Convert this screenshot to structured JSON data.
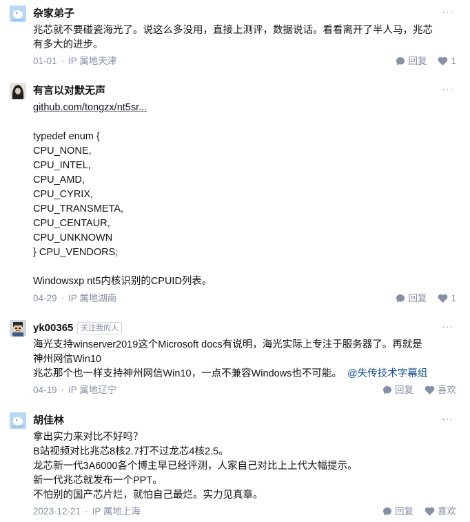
{
  "colors": {
    "meta": "#8590a6",
    "text": "#121212",
    "mention": "#175199",
    "background": "#ffffff"
  },
  "comments": [
    {
      "author": "杂家弟子",
      "avatar_icon": "blue-bird-default-avatar",
      "body_lines": [
        "兆芯就不要碰瓷海光了。说这么多没用，直接上测评，数据说话。看看离开了半人马，兆芯",
        "有多大的进步。"
      ],
      "date": "01-01",
      "location": "IP 属地天津",
      "reply_label": "回复",
      "like_count": "1"
    },
    {
      "author": "有言以对默无声",
      "avatar_icon": "dark-portrait-avatar",
      "link_text": "github.com/tongzx/nt5sr...",
      "body_lines": [
        "",
        "typedef enum {",
        "CPU_NONE,",
        "CPU_INTEL,",
        "CPU_AMD,",
        "CPU_CYRIX,",
        "CPU_TRANSMETA,",
        "CPU_CENTAUR,",
        "CPU_UNKNOWN",
        "} CPU_VENDORS;",
        "",
        "Windowsxp nt5内核识别的CPUID列表。"
      ],
      "date": "04-29",
      "location": "IP 属地湖南",
      "reply_label": "回复",
      "like_count": "1"
    },
    {
      "author": "yk00365",
      "badge": "关注我的人",
      "avatar_icon": "pixel-character-avatar",
      "body_lines": [
        "海光支持winserver2019这个Microsoft docs有说明，海光实际上专注于服务器了。再就是",
        "神州网信Win10",
        "兆芯那个也一样支持神州网信Win10，一点不兼容Windows也不可能。"
      ],
      "mention": "@失传技术字幕组",
      "date": "04-19",
      "location": "IP 属地辽宁",
      "reply_label": "回复",
      "like_label": "喜欢"
    },
    {
      "author": "胡佳林",
      "avatar_icon": "blue-bird-default-avatar",
      "body_lines": [
        "拿出实力来对比不好吗？",
        "B站视频对比兆芯8核2.7打不过龙芯4核2.5。",
        "龙芯新一代3A6000各个博主早已经评测，人家自己对比上上代大幅提示。",
        "新一代兆芯就发布一个PPT。",
        "不怕别的国产芯片烂，就怕自己最烂。实力见真章。"
      ],
      "date": "2023-12-21",
      "location": "IP 属地上海",
      "reply_label": "回复",
      "like_label": "喜欢"
    }
  ]
}
